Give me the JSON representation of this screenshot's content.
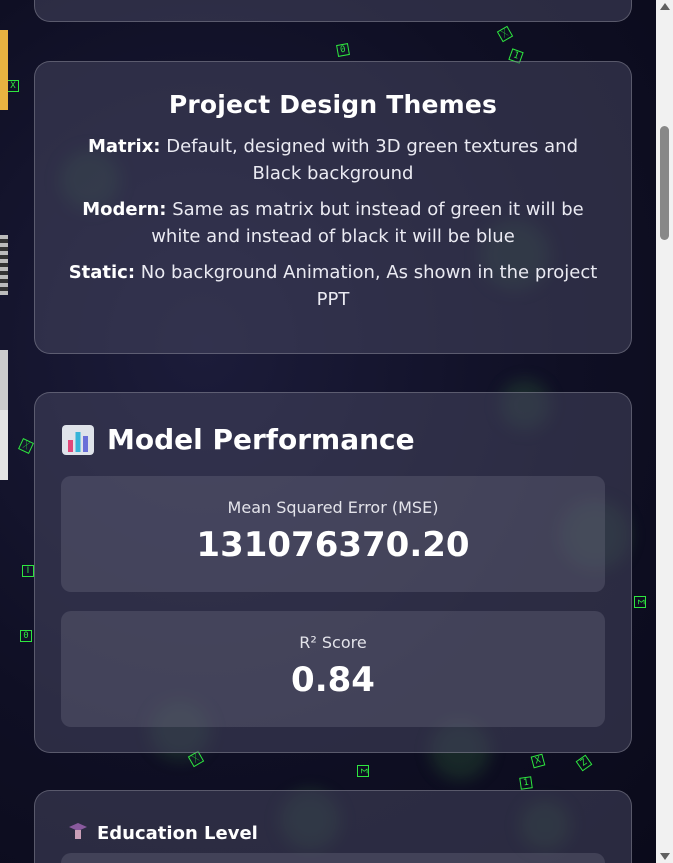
{
  "themes": {
    "title": "Project Design Themes",
    "items": [
      {
        "name": "Matrix:",
        "desc": " Default, designed with 3D green textures and Black background"
      },
      {
        "name": "Modern:",
        "desc": " Same as matrix but instead of green it will be white and instead of black it will be blue"
      },
      {
        "name": "Static:",
        "desc": " No background Animation, As shown in the project PPT"
      }
    ]
  },
  "performance": {
    "icon": "bar-chart-icon",
    "title": "Model Performance",
    "metrics": [
      {
        "label": "Mean Squared Error (MSE)",
        "value": "131076370.20"
      },
      {
        "label": "R² Score",
        "value": "0.84"
      }
    ]
  },
  "education": {
    "icon": "graduation-cap-icon",
    "label": "Education Level"
  },
  "colors": {
    "matrix_green": "#2ee63f",
    "background": "#12122a"
  }
}
